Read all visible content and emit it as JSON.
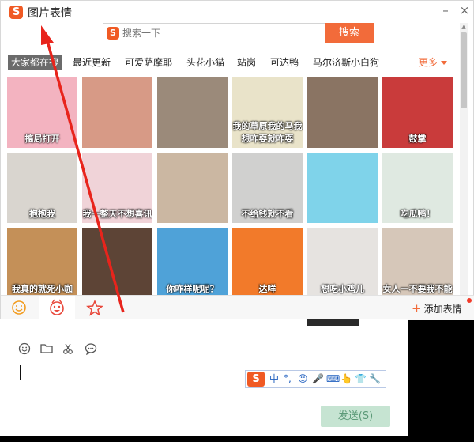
{
  "window": {
    "title": "图片表情",
    "logo_text": "S",
    "close": "×",
    "minimize": "–"
  },
  "search": {
    "placeholder": "搜索一下",
    "button": "搜索"
  },
  "tabs": [
    "大家都在搜",
    "最近更新",
    "可爱萨摩耶",
    "头花小猫",
    "站岗",
    "可达鸭",
    "马尔济斯小白狗"
  ],
  "more": "更多",
  "stickers": [
    {
      "caption": "搞局打开",
      "bg": "#f3b3c0"
    },
    {
      "caption": "",
      "bg": "#d79a86"
    },
    {
      "caption": "",
      "bg": "#9b8a7a"
    },
    {
      "caption": "我的草原我的马我想咋耍就咋耍",
      "bg": "#e9e3c9"
    },
    {
      "caption": "",
      "bg": "#8a7463"
    },
    {
      "caption": "鼓掌",
      "bg": "#c93b3b"
    },
    {
      "caption": "抱抱我",
      "bg": "#d9d5cf"
    },
    {
      "caption": "我一整天不想喜讯",
      "bg": "#f0d3d8"
    },
    {
      "caption": "",
      "bg": "#cbb7a2"
    },
    {
      "caption": "不给钱就不看",
      "bg": "#d0d0cf"
    },
    {
      "caption": "",
      "bg": "#7fd3ea"
    },
    {
      "caption": "吃瓜鸭！",
      "bg": "#dfe9e1"
    },
    {
      "caption": "我真的就死小咖",
      "bg": "#c49058"
    },
    {
      "caption": "",
      "bg": "#5d4436"
    },
    {
      "caption": "你咋样呢呢？",
      "bg": "#4fa2d8"
    },
    {
      "caption": "达咩",
      "bg": "#f27a2a"
    },
    {
      "caption": "想吃小鸡儿",
      "bg": "#e6e3e0"
    },
    {
      "caption": "女人一不要我不能",
      "bg": "#d6c7b9"
    }
  ],
  "bottom": {
    "add_sticker": "添加表情"
  },
  "chat": {
    "send": "发送(S)"
  },
  "ime": {
    "logo": "S",
    "items": [
      "中",
      "°,",
      "☺",
      "🎤",
      "⌨",
      "👆",
      "👕",
      "🔧"
    ]
  }
}
